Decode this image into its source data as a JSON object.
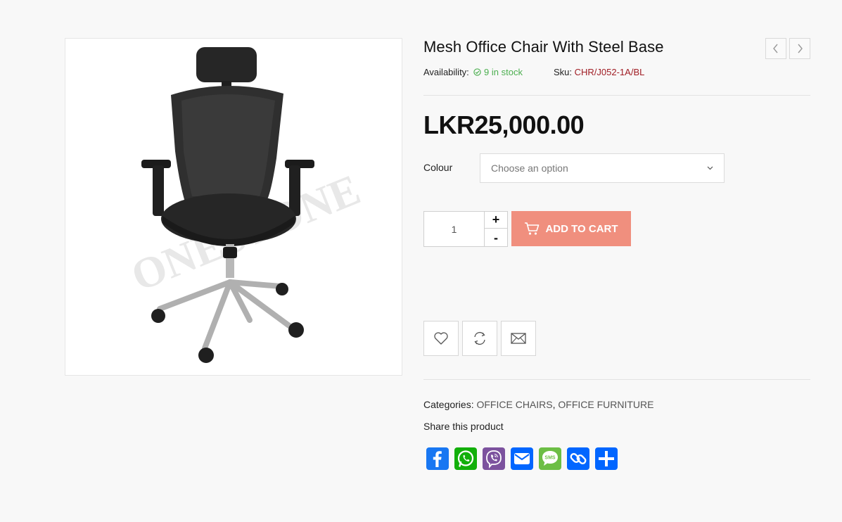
{
  "product": {
    "title": "Mesh Office Chair With Steel Base",
    "availability_label": "Availability:",
    "stock_text": "9 in stock",
    "sku_label": "Sku:",
    "sku_value": "CHR/J052-1A/BL",
    "price": "LKR25,000.00",
    "watermark_text": "ONESTONE"
  },
  "options": {
    "colour_label": "Colour",
    "colour_select_value": "Choose an option"
  },
  "cart": {
    "quantity": "1",
    "plus_label": "+",
    "minus_label": "-",
    "add_to_cart_label": "ADD TO CART"
  },
  "meta": {
    "categories_label": "Categories:",
    "categories": [
      "OFFICE CHAIRS",
      "OFFICE FURNITURE"
    ],
    "categories_separator": ", ",
    "share_label": "Share this product"
  },
  "share_services": [
    {
      "name": "facebook",
      "color": "#1877f2"
    },
    {
      "name": "whatsapp",
      "color": "#12af0a"
    },
    {
      "name": "viber",
      "color": "#7c529e"
    },
    {
      "name": "email",
      "color": "#0166ff"
    },
    {
      "name": "sms",
      "color": "#6cbe45"
    },
    {
      "name": "copy-link",
      "color": "#0166ff"
    },
    {
      "name": "share",
      "color": "#0166ff"
    }
  ],
  "colors": {
    "accent_button": "#f08f7e",
    "in_stock": "#4caf50",
    "sku": "#a01d24"
  }
}
